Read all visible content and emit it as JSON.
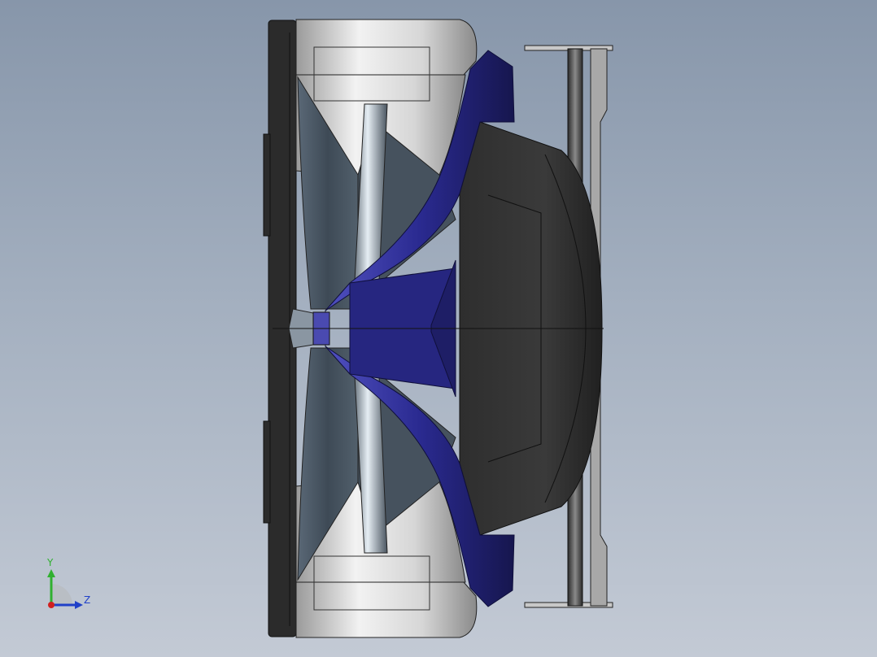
{
  "viewport": {
    "colors": {
      "background_top": "#8796aa",
      "background_bottom": "#c3cad5",
      "body_blue": "#2a2a8c",
      "tyre_black": "#2a2a2a",
      "panel_silver": "#c8c8c8"
    }
  },
  "triad": {
    "y_label": "Y",
    "z_label": "Z",
    "colors": {
      "x_axis": "#d02020",
      "y_axis": "#30b030",
      "z_axis": "#2040c8"
    }
  }
}
